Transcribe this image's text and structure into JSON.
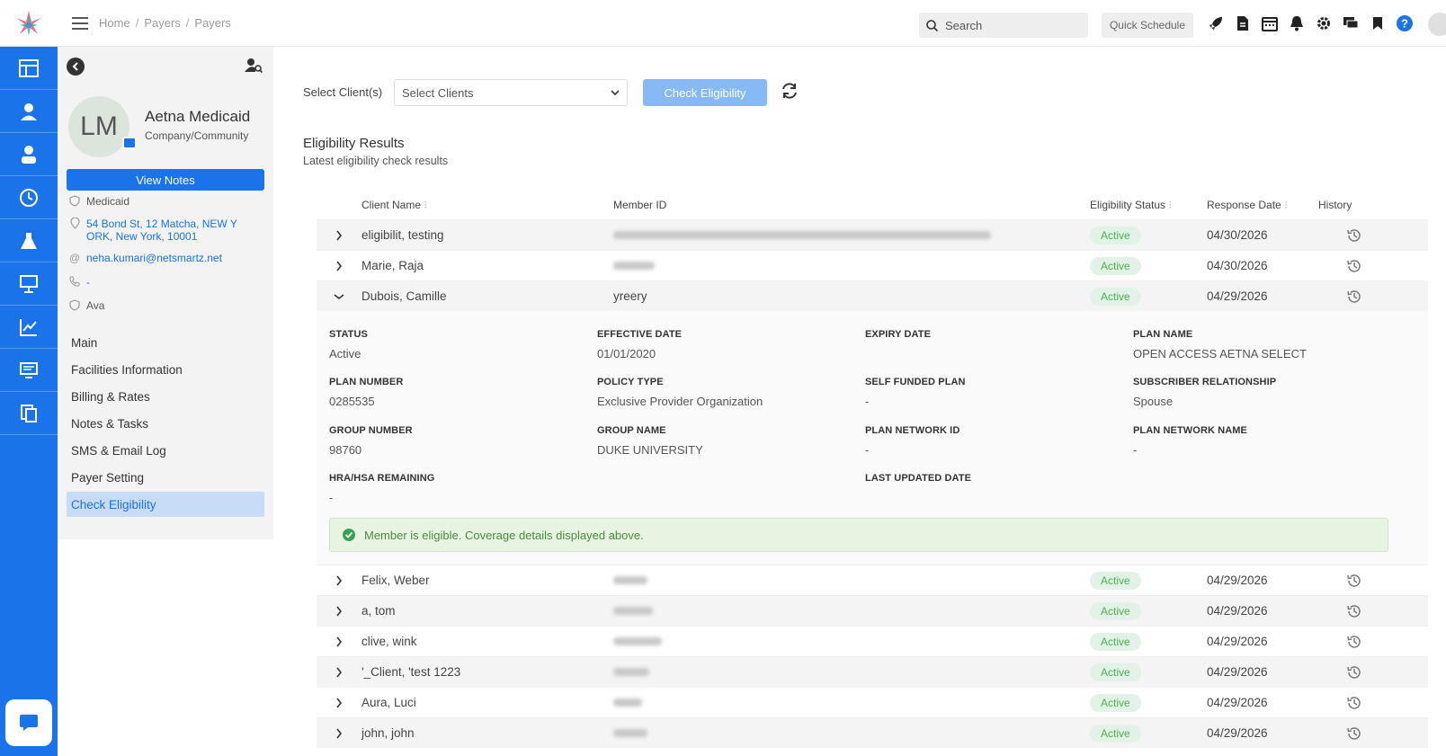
{
  "breadcrumb": [
    "Home",
    "Payers",
    "Payers"
  ],
  "header": {
    "search_label": "Search",
    "quick_schedule": "Quick Schedule",
    "icons": [
      "rocket-icon",
      "document-icon",
      "calendar-icon",
      "bell-icon",
      "gear-icon",
      "chat-icon",
      "bookmark-icon",
      "help-icon"
    ]
  },
  "rail": {
    "items": [
      "dashboard-icon",
      "client-icon",
      "staff-icon",
      "clock-icon",
      "lab-icon",
      "presentation-icon",
      "chart-icon",
      "monitor-icon",
      "files-icon"
    ]
  },
  "profile": {
    "initials": "LM",
    "name": "Aetna Medicaid",
    "type": "Company/Community",
    "view_notes": "View Notes",
    "category": "Medicaid",
    "address": "54 Bond St, 12 Matcha, NEW Y ORK, New York, 10001",
    "email": "neha.kumari@netsmartz.net",
    "phone": "-",
    "contact": "Ava"
  },
  "nav": {
    "items": [
      "Main",
      "Facilities Information",
      "Billing & Rates",
      "Notes & Tasks",
      "SMS & Email Log",
      "Payer Setting",
      "Check Eligibility"
    ],
    "active": "Check Eligibility"
  },
  "toolbar": {
    "select_label": "Select Client(s)",
    "select_placeholder": "Select Clients",
    "check_button": "Check Eligibility"
  },
  "results": {
    "title": "Eligibility Results",
    "subtitle": "Latest eligibility check results",
    "columns": [
      "Client Name",
      "Member ID",
      "Eligibility Status",
      "Response Date",
      "History"
    ],
    "rows_top": [
      {
        "name": "eligibilit, testing",
        "member_id": "",
        "status": "Active",
        "date": "04/30/2026"
      },
      {
        "name": "Marie, Raja",
        "member_id": "",
        "status": "Active",
        "date": "04/30/2026"
      },
      {
        "name": "Dubois, Camille",
        "member_id": "yreery",
        "status": "Active",
        "date": "04/29/2026"
      }
    ],
    "details": {
      "status_label": "STATUS",
      "status": "Active",
      "effective_label": "EFFECTIVE DATE",
      "effective": "01/01/2020",
      "expiry_label": "EXPIRY DATE",
      "expiry": "",
      "plan_name_label": "PLAN NAME",
      "plan_name": "OPEN ACCESS AETNA SELECT",
      "plan_number_label": "PLAN NUMBER",
      "plan_number": "0285535",
      "policy_type_label": "POLICY TYPE",
      "policy_type": "Exclusive Provider Organization",
      "self_funded_label": "SELF FUNDED PLAN",
      "self_funded": "-",
      "subscriber_label": "SUBSCRIBER RELATIONSHIP",
      "subscriber": "Spouse",
      "group_number_label": "GROUP NUMBER",
      "group_number": "98760",
      "group_name_label": "GROUP NAME",
      "group_name": "DUKE UNIVERSITY",
      "network_id_label": "PLAN NETWORK ID",
      "network_id": "-",
      "network_name_label": "PLAN NETWORK NAME",
      "network_name": "-",
      "hra_label": "HRA/HSA REMAINING",
      "hra": "-",
      "last_updated_label": "LAST UPDATED DATE",
      "last_updated": "",
      "banner": "Member is eligible. Coverage details displayed above."
    },
    "rows_bottom": [
      {
        "name": "Felix, Weber",
        "status": "Active",
        "date": "04/29/2026"
      },
      {
        "name": "a, tom",
        "status": "Active",
        "date": "04/29/2026"
      },
      {
        "name": "clive, wink",
        "status": "Active",
        "date": "04/29/2026"
      },
      {
        "name": "'_Client, 'test 1223",
        "status": "Active",
        "date": "04/29/2026"
      },
      {
        "name": "Aura, Luci",
        "status": "Active",
        "date": "04/29/2026"
      },
      {
        "name": "john, john",
        "status": "Active",
        "date": "04/29/2026"
      }
    ]
  }
}
